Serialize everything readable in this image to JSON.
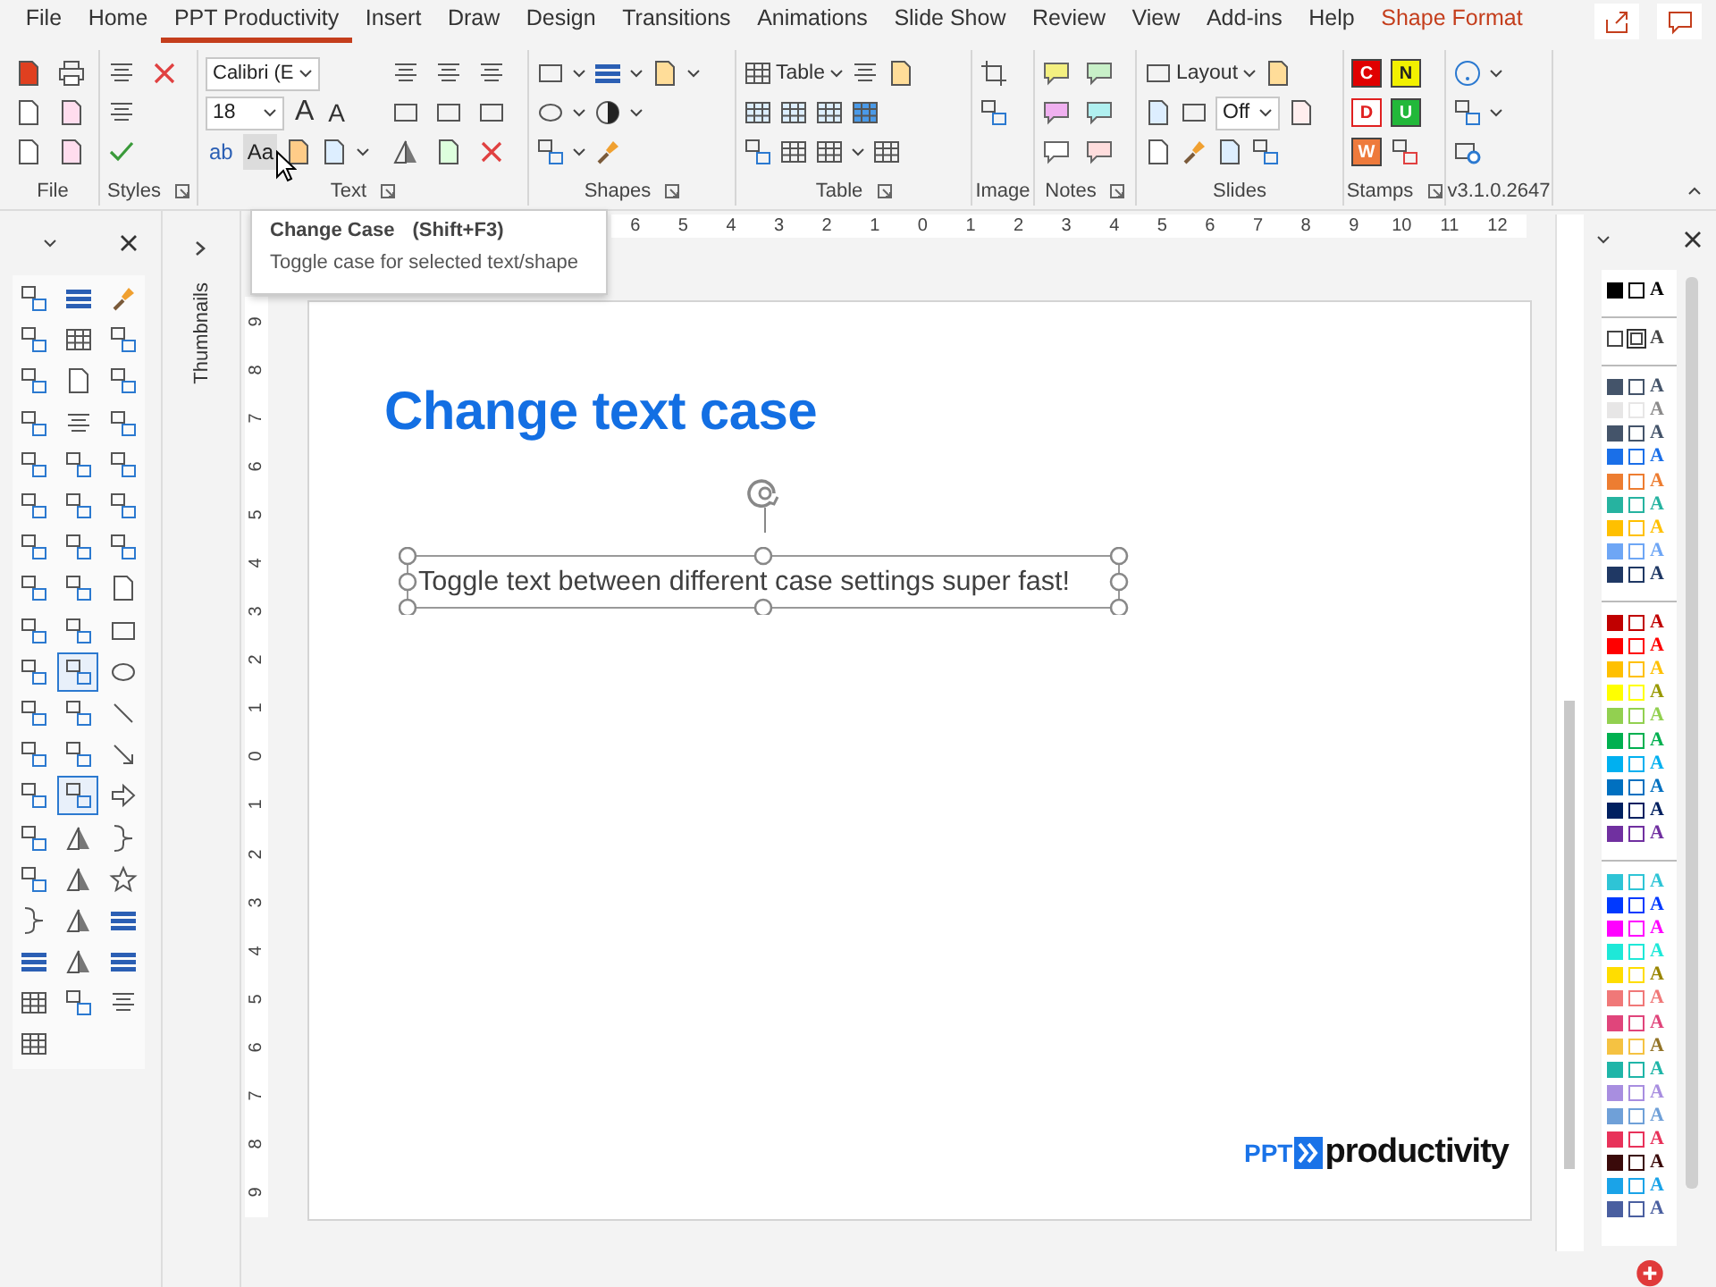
{
  "tabs": [
    {
      "label": "File",
      "selected": false,
      "contextual": false
    },
    {
      "label": "Home",
      "selected": false,
      "contextual": false
    },
    {
      "label": "PPT Productivity",
      "selected": true,
      "contextual": false
    },
    {
      "label": "Insert",
      "selected": false,
      "contextual": false
    },
    {
      "label": "Draw",
      "selected": false,
      "contextual": false
    },
    {
      "label": "Design",
      "selected": false,
      "contextual": false
    },
    {
      "label": "Transitions",
      "selected": false,
      "contextual": false
    },
    {
      "label": "Animations",
      "selected": false,
      "contextual": false
    },
    {
      "label": "Slide Show",
      "selected": false,
      "contextual": false
    },
    {
      "label": "Review",
      "selected": false,
      "contextual": false
    },
    {
      "label": "View",
      "selected": false,
      "contextual": false
    },
    {
      "label": "Add-ins",
      "selected": false,
      "contextual": false
    },
    {
      "label": "Help",
      "selected": false,
      "contextual": false
    },
    {
      "label": "Shape Format",
      "selected": false,
      "contextual": true
    }
  ],
  "ribbon": {
    "groups": [
      {
        "kind": "file",
        "label": "File"
      },
      {
        "kind": "styles",
        "label": "Styles"
      },
      {
        "kind": "text",
        "label": "Text"
      },
      {
        "kind": "shapes",
        "label": "Shapes"
      },
      {
        "kind": "table",
        "label": "Table"
      },
      {
        "kind": "image",
        "label": "Image"
      },
      {
        "kind": "notes",
        "label": "Notes"
      },
      {
        "kind": "slides",
        "label": "Slides"
      },
      {
        "kind": "stamps",
        "label": "Stamps"
      },
      {
        "kind": "version",
        "label": "v3.1.0.2647"
      }
    ],
    "font": "Calibri (E",
    "size": "18",
    "grow": "A",
    "shrink": "A",
    "text_tools": [
      {
        "glyph": "ab",
        "hovered": false
      },
      {
        "glyph": "Aa",
        "hovered": true
      }
    ],
    "table_button": "Table",
    "layout_button": "Layout",
    "slide_number_combo": "Off",
    "stamps": [
      {
        "letter": "C",
        "color": "#e00000",
        "kind": "filled"
      },
      {
        "letter": "N",
        "color": "#f2f000",
        "kind": "filled"
      },
      {
        "letter": "D",
        "color": "#e02020",
        "kind": "outline"
      },
      {
        "letter": "U",
        "color": "#22b83a",
        "kind": "filled"
      },
      {
        "letter": "W",
        "color": "#ee7a3c",
        "kind": "filled"
      }
    ]
  },
  "tooltip": {
    "title": "Change Case",
    "shortcut": "(Shift+F3)",
    "description": "Toggle case for selected text/shape"
  },
  "left_toolbar": {
    "columns": [
      [
        {
          "on": false
        },
        {
          "on": false
        },
        {
          "on": false
        },
        {
          "on": false
        },
        {
          "on": false
        },
        {
          "on": false
        },
        {
          "on": false
        },
        {
          "on": false
        },
        {
          "on": false
        },
        {
          "on": false
        },
        {
          "on": false
        },
        {
          "on": false
        },
        {
          "on": false
        },
        {
          "on": false
        },
        {
          "on": false
        },
        {
          "on": false
        },
        {
          "on": false
        },
        {
          "on": false
        },
        {
          "on": false
        }
      ],
      [
        {
          "on": false
        },
        {
          "on": false
        },
        {
          "on": false
        },
        {
          "on": false
        },
        {
          "on": false
        },
        {
          "on": false
        },
        {
          "on": false
        },
        {
          "on": false
        },
        {
          "on": false
        },
        {
          "on": true
        },
        {
          "on": false
        },
        {
          "on": false
        },
        {
          "on": true
        },
        {
          "on": false
        },
        {
          "on": false
        },
        {
          "on": false
        },
        {
          "on": false
        },
        {
          "on": false
        }
      ],
      [
        {
          "on": false
        },
        {
          "on": false
        },
        {
          "on": false
        },
        {
          "on": false
        },
        {
          "on": false
        },
        {
          "on": false
        },
        {
          "on": false
        },
        {
          "on": false
        },
        {
          "on": false
        },
        {
          "on": false
        },
        {
          "on": false
        },
        {
          "on": false
        },
        {
          "on": false
        },
        {
          "on": false
        },
        {
          "on": false
        },
        {
          "on": false
        },
        {
          "on": false
        },
        {
          "on": false
        }
      ]
    ]
  },
  "thumbnails_label": "Thumbnails",
  "ruler": {
    "horizontal": [
      "6",
      "5",
      "4",
      "3",
      "2",
      "1",
      "0",
      "1",
      "2",
      "3",
      "4",
      "5",
      "6",
      "7",
      "8",
      "9",
      "10",
      "11",
      "12"
    ],
    "vertical": [
      "9",
      "8",
      "7",
      "6",
      "5",
      "4",
      "3",
      "2",
      "1",
      "0",
      "1",
      "2",
      "3",
      "4",
      "5",
      "6",
      "7",
      "8",
      "9"
    ]
  },
  "slide": {
    "title": "Change text case",
    "body": "Toggle text between different case settings super fast!",
    "logo": {
      "prefix": "PPT",
      "name": "productivity"
    }
  },
  "palette": {
    "groups": [
      [
        {
          "kind": "standard",
          "color": "#000000",
          "letter": "A"
        }
      ],
      [
        {
          "kind": "double",
          "color": "#444444",
          "letter": "A"
        }
      ],
      [
        {
          "kind": "standard",
          "color": "#44546a",
          "letter": "A"
        },
        {
          "kind": "standard",
          "color": "#e7e6e6",
          "letter": "A"
        },
        {
          "kind": "standard",
          "color": "#44546a",
          "letter": "A"
        },
        {
          "kind": "standard",
          "color": "#1a6fe8",
          "letter": "A"
        },
        {
          "kind": "standard",
          "color": "#ed7d31",
          "letter": "A"
        },
        {
          "kind": "standard",
          "color": "#26b3a0",
          "letter": "A"
        },
        {
          "kind": "standard",
          "color": "#ffc000",
          "letter": "A"
        },
        {
          "kind": "standard",
          "color": "#6ea6f5",
          "letter": "A"
        },
        {
          "kind": "standard",
          "color": "#1f3864",
          "letter": "A"
        }
      ],
      [
        {
          "kind": "standard",
          "color": "#c00000",
          "letter": "A"
        },
        {
          "kind": "standard",
          "color": "#ff0000",
          "letter": "A"
        },
        {
          "kind": "standard",
          "color": "#ffc000",
          "letter": "A"
        },
        {
          "kind": "standard",
          "color": "#ffff00",
          "letter": "A"
        },
        {
          "kind": "standard",
          "color": "#92d050",
          "letter": "A"
        },
        {
          "kind": "standard",
          "color": "#00b050",
          "letter": "A"
        },
        {
          "kind": "standard",
          "color": "#00b0f0",
          "letter": "A"
        },
        {
          "kind": "standard",
          "color": "#0070c0",
          "letter": "A"
        },
        {
          "kind": "standard",
          "color": "#002060",
          "letter": "A"
        },
        {
          "kind": "standard",
          "color": "#7030a0",
          "letter": "A"
        }
      ],
      [
        {
          "kind": "standard",
          "color": "#2ec4d6",
          "letter": "A"
        },
        {
          "kind": "standard",
          "color": "#0039ff",
          "letter": "A"
        },
        {
          "kind": "standard",
          "color": "#ff00ff",
          "letter": "A"
        },
        {
          "kind": "standard",
          "color": "#1ee8d8",
          "letter": "A"
        },
        {
          "kind": "standard",
          "color": "#ffdd00",
          "letter": "A"
        },
        {
          "kind": "standard",
          "color": "#f07878",
          "letter": "A"
        },
        {
          "kind": "standard",
          "color": "#e0457b",
          "letter": "A"
        },
        {
          "kind": "standard",
          "color": "#f5c242",
          "letter": "A"
        },
        {
          "kind": "standard",
          "color": "#1fb5a8",
          "letter": "A"
        },
        {
          "kind": "standard",
          "color": "#a88ee0",
          "letter": "A"
        },
        {
          "kind": "standard",
          "color": "#6fa0d8",
          "letter": "A"
        },
        {
          "kind": "standard",
          "color": "#e8325a",
          "letter": "A"
        },
        {
          "kind": "standard",
          "color": "#3a0a0a",
          "letter": "A"
        },
        {
          "kind": "standard",
          "color": "#1aa3e8",
          "letter": "A"
        },
        {
          "kind": "standard",
          "color": "#4a5fa0",
          "letter": "A"
        }
      ]
    ]
  }
}
